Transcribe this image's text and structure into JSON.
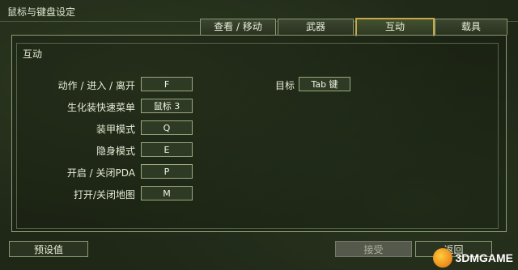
{
  "window": {
    "title": "鼠标与键盘设定"
  },
  "tabs": [
    {
      "label": "查看 / 移动",
      "active": false
    },
    {
      "label": "武器",
      "active": false
    },
    {
      "label": "互动",
      "active": true
    },
    {
      "label": "载具",
      "active": false
    }
  ],
  "section": {
    "title": "互动"
  },
  "bindings": [
    {
      "label": "动作 / 进入 / 离开",
      "key": "F"
    },
    {
      "label": "生化装快速菜单",
      "key": "鼠标 3"
    },
    {
      "label": "装甲模式",
      "key": "Q"
    },
    {
      "label": "隐身模式",
      "key": "E"
    },
    {
      "label": "开启 / 关闭PDA",
      "key": "P"
    },
    {
      "label": "打开/关闭地图",
      "key": "M"
    }
  ],
  "extra_binding": {
    "label": "目标",
    "key": "Tab 键"
  },
  "buttons": {
    "defaults": "预设值",
    "accept": "接受",
    "back": "返回"
  },
  "watermark": {
    "text": "3DMGAME"
  },
  "colors": {
    "background": "#1f2717",
    "border": "#8b9a74",
    "active_tab_border": "#c9a84a",
    "button_fill": "#2f3a25"
  }
}
